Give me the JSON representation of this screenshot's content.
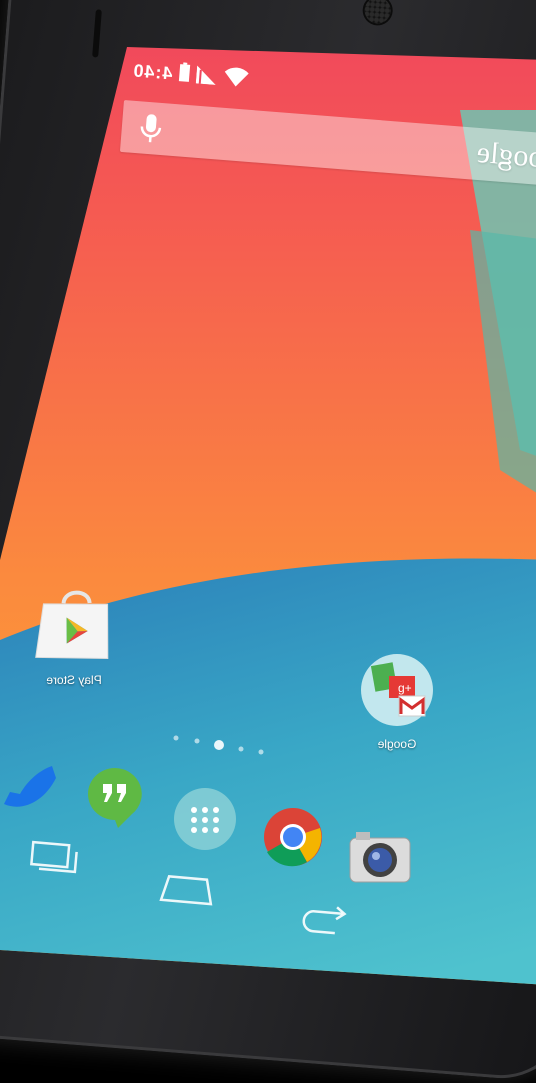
{
  "status_bar": {
    "time": "4:40",
    "icons": [
      "signal-icon",
      "wifi-icon",
      "battery-icon"
    ]
  },
  "search": {
    "logo": "Google",
    "icon": "mic-icon"
  },
  "home_apps": [
    {
      "label": "Play Store",
      "icon": "play-store-icon"
    },
    {
      "label": "Google",
      "icon": "google-folder-icon"
    }
  ],
  "page_indicator": {
    "count": 5,
    "active": 3
  },
  "dock": [
    "phone-icon",
    "hangouts-icon",
    "app-drawer-icon",
    "chrome-icon",
    "camera-icon"
  ],
  "nav": [
    "recent-apps-icon",
    "home-icon",
    "back-icon"
  ],
  "colors": {
    "wall_top": "#f2485e",
    "wall_orange": "#fb8a3e",
    "wall_teal": "#3aa7c2",
    "accent": "#ffffff"
  }
}
